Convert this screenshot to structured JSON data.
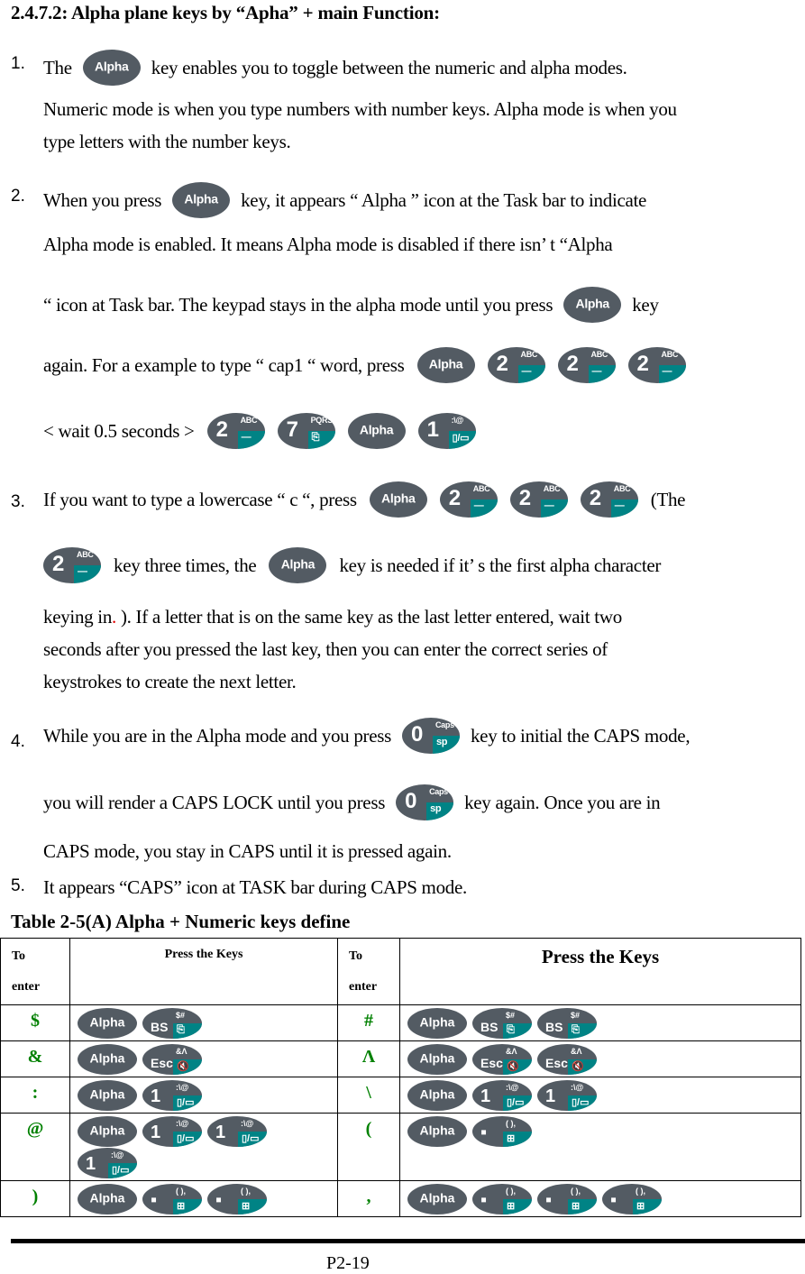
{
  "heading": "2.4.7.2: Alpha plane keys by “Apha” + main Function:",
  "keys": {
    "alpha": {
      "label": "Alpha"
    },
    "two": {
      "main": "2",
      "sup": "ABC",
      "sub": "—"
    },
    "seven": {
      "main": "7",
      "sup": "PQRS",
      "sub": "⎘"
    },
    "one": {
      "main": "1",
      "sup": ":\\@",
      "sub": "▯/▭"
    },
    "zero": {
      "main": "0",
      "sup": "Caps",
      "sub": "sp"
    },
    "bs": {
      "main": "BS",
      "sup": "$#",
      "sub": "⎘"
    },
    "esc": {
      "main": "Esc",
      "sup": "&Λ",
      "sub": "🔇"
    },
    "dot": {
      "main": "▪",
      "sup": "( ),",
      "sub": "⊞"
    }
  },
  "colors": {
    "key_body": "#535b63",
    "key_accent": "#008385",
    "symbol_green": "#008000",
    "note_red": "#e00000"
  },
  "items": [
    {
      "number": "1.",
      "lines": [
        {
          "before": "The",
          "after": "key enables you to toggle between the numeric and alpha modes."
        },
        {
          "text": "Numeric mode is when you type numbers with number keys. Alpha mode is when you"
        },
        {
          "text": "type letters with the number keys."
        }
      ]
    },
    {
      "number": "2.",
      "lines": [
        {
          "before": "When you press",
          "after": "key, it appears  “ Alpha ”  icon at the Task bar to indicate"
        },
        {
          "text": "Alpha mode is enabled. It means Alpha mode is disabled if there isn’ t  “Alpha"
        },
        {
          "before": " “ icon at Task bar. The keypad stays in the alpha mode until you press",
          "after": "key"
        },
        {
          "before": "again. For a example to type  “ cap1  “ word, press"
        },
        {
          "before": "< wait 0.5 seconds >"
        }
      ]
    },
    {
      "number": "3.",
      "lines": [
        {
          "before": "If you want to type a lowercase  “ c  “, press",
          "after": "(The"
        },
        {
          "middle": "key three times, the",
          "after": "key is needed if it’ s the first alpha character"
        },
        {
          "before": "keying in",
          "red": ".",
          "after": " ). If a letter that is on the same key as the last letter entered, wait two"
        },
        {
          "text": "seconds after you pressed the last key,   then you can enter the correct series of"
        },
        {
          "text": "keystrokes to create the next letter."
        }
      ]
    },
    {
      "number": "4.",
      "lines": [
        {
          "before": "While you are in the Alpha mode and you press",
          "after": "key to initial the CAPS mode,"
        },
        {
          "before": "you will render a CAPS LOCK until you press",
          "after": "key again. Once you are in"
        },
        {
          "text": "CAPS mode, you stay in CAPS until it is pressed again."
        }
      ]
    },
    {
      "number": "5.",
      "lines": [
        {
          "text": "It appears  “CAPS”  icon at TASK bar during CAPS mode."
        }
      ]
    }
  ],
  "table": {
    "caption": "Table 2-5(A) Alpha + Numeric keys define",
    "headers": {
      "to_enter_line1": "To",
      "to_enter_line2": "enter",
      "press_keys": "Press the Keys"
    },
    "rows": [
      {
        "left_symbol": "$",
        "left_keys": [
          "alpha",
          "bs"
        ],
        "right_symbol": "#",
        "right_keys": [
          "alpha",
          "bs",
          "bs"
        ]
      },
      {
        "left_symbol": "&",
        "left_keys": [
          "alpha",
          "esc"
        ],
        "right_symbol": "Λ",
        "right_keys": [
          "alpha",
          "esc",
          "esc"
        ]
      },
      {
        "left_symbol": ":",
        "left_keys": [
          "alpha",
          "one"
        ],
        "right_symbol": "\\",
        "right_keys": [
          "alpha",
          "one",
          "one"
        ]
      },
      {
        "left_symbol": "@",
        "left_keys": [
          "alpha",
          "one",
          "one",
          "one"
        ],
        "right_symbol": "(",
        "right_keys": [
          "alpha",
          "dot"
        ]
      },
      {
        "left_symbol": ")",
        "left_keys": [
          "alpha",
          "dot",
          "dot"
        ],
        "right_symbol": ",",
        "right_keys": [
          "alpha",
          "dot",
          "dot",
          "dot"
        ]
      }
    ]
  },
  "footer": {
    "page_number": "P2-19"
  }
}
